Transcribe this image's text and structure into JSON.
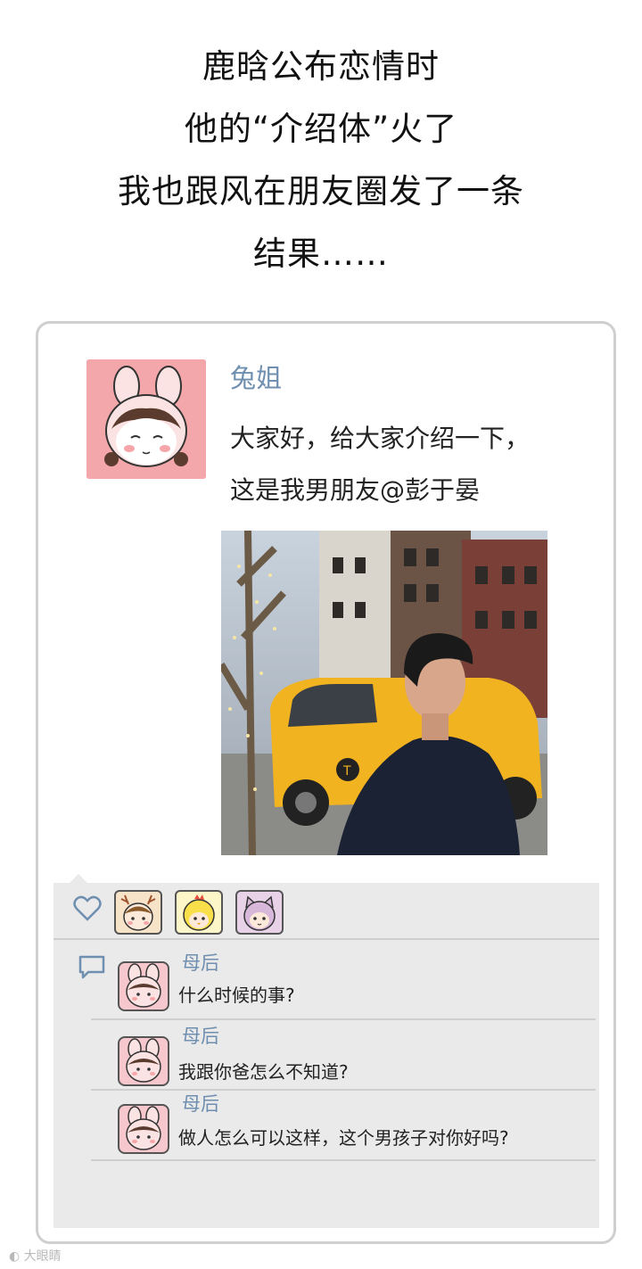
{
  "headline": {
    "line1": "鹿晗公布恋情时",
    "line2": "他的“介绍体”火了",
    "line3": "我也跟风在朋友圈发了一条",
    "line4": "结果……"
  },
  "post": {
    "username": "兔姐",
    "text_line1": "大家好，给大家介绍一下，",
    "text_line2": "这是我男朋友@彭于晏"
  },
  "likes": {
    "icon": "heart-icon",
    "avatars": [
      "deer-avatar",
      "chick-avatar",
      "cat-avatar"
    ]
  },
  "comments": [
    {
      "name": "母后",
      "text": "什么时候的事?"
    },
    {
      "name": "母后",
      "text": "我跟你爸怎么不知道?"
    },
    {
      "name": "母后",
      "text": "做人怎么可以这样，这个男孩子对你好吗?"
    }
  ],
  "watermark": "大眼睛"
}
